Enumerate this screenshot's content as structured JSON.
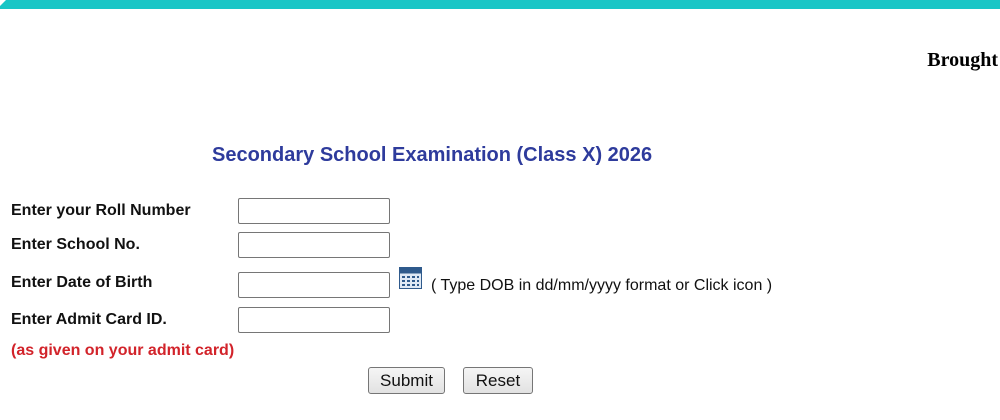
{
  "header": {
    "banner_color": "#19c6c6",
    "brought_text": "Brought"
  },
  "title": "Secondary School Examination (Class X) 2026",
  "form": {
    "roll_number": {
      "label": "Enter your Roll Number",
      "value": ""
    },
    "school_no": {
      "label": "Enter School No.",
      "value": ""
    },
    "dob": {
      "label": "Enter Date of Birth",
      "value": "",
      "hint": "( Type DOB in dd/mm/yyyy format or Click icon )",
      "icon": "calendar-icon"
    },
    "admit_card_id": {
      "label": "Enter Admit Card ID.",
      "value": ""
    },
    "note": "(as given on your admit card)"
  },
  "buttons": {
    "submit": "Submit",
    "reset": "Reset"
  },
  "colors": {
    "title": "#2e3b9c",
    "note": "#d2232a"
  }
}
